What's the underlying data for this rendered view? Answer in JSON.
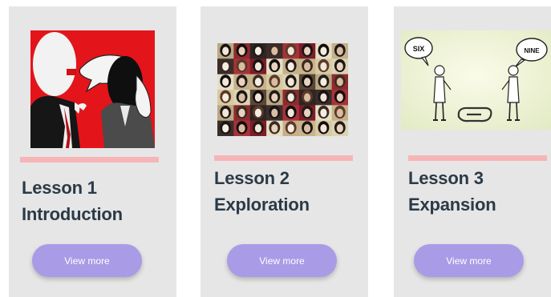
{
  "lessons": [
    {
      "image_icon": "two-figures-talking-illustration",
      "title_line1": "Lesson 1",
      "title_line2": "Introduction",
      "button_label": "View more"
    },
    {
      "image_icon": "portrait-grid-illustration",
      "title_line1": "Lesson 2",
      "title_line2": "Exploration",
      "button_label": "View more"
    },
    {
      "image_icon": "six-nine-perspective-cartoon",
      "title_line1": "Lesson 3",
      "title_line2": "Expansion",
      "button_label": "View more",
      "image_text_left": "SIX",
      "image_text_right": "NINE"
    }
  ],
  "colors": {
    "card_bg": "#e6e6e6",
    "divider": "#f7b5b8",
    "title_text": "#2b3a47",
    "button_bg": "#a99be6",
    "button_text": "#ffffff"
  }
}
